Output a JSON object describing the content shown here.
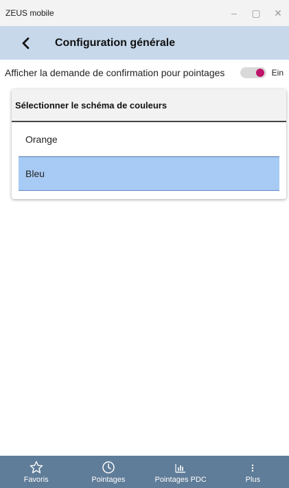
{
  "window": {
    "title": "ZEUS mobile",
    "controls": {
      "minimize": "–",
      "maximize": "▢",
      "close": "✕"
    }
  },
  "header": {
    "back_icon": "chevron-left-icon",
    "title": "Configuration générale",
    "background": "#c7d8ea"
  },
  "settings": {
    "confirmation_label": "Afficher la demande de confirmation pour pointages",
    "confirmation_state": "Ein",
    "toggle_on": true,
    "toggle_color": "#c0146a"
  },
  "color_scheme": {
    "title": "Sélectionner le schéma de couleurs",
    "options": [
      "Orange",
      "Bleu"
    ],
    "selected": "Bleu",
    "selected_color": "#a8cbf5"
  },
  "bottom_nav": {
    "background": "#5f7c98",
    "items": [
      {
        "label": "Favoris",
        "icon": "star-icon"
      },
      {
        "label": "Pointages",
        "icon": "clock-icon"
      },
      {
        "label": "Pointages PDC",
        "icon": "bar-chart-icon"
      },
      {
        "label": "Plus",
        "icon": "more-vertical-icon"
      }
    ]
  }
}
